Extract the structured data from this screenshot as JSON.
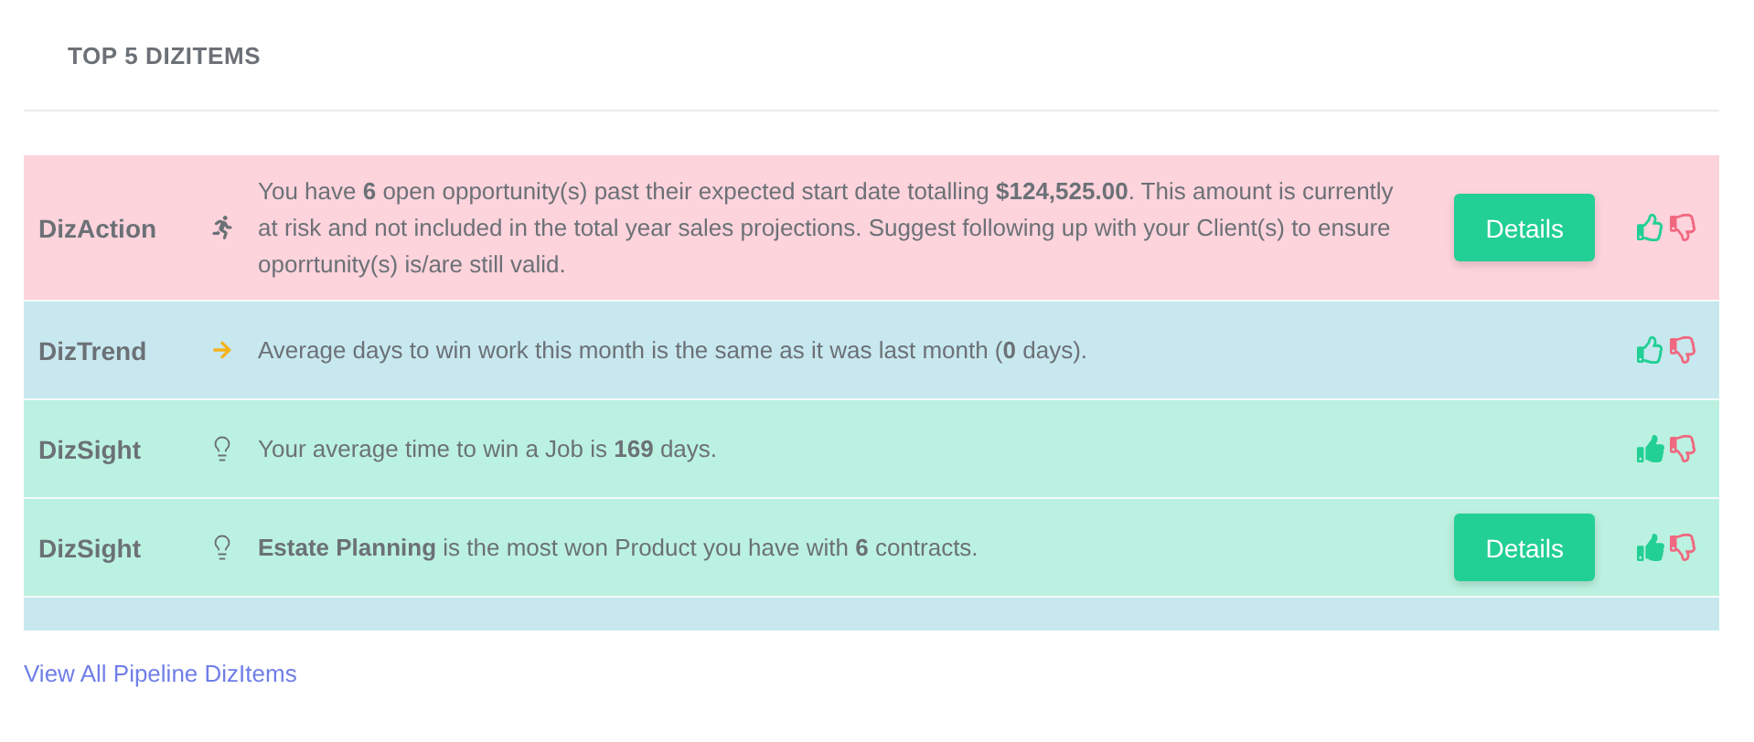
{
  "title": "TOP 5 DIZITEMS",
  "items": [
    {
      "kind": "action",
      "label": "DizAction",
      "text": "You have **6** open opportunity(s) past their expected start date totalling **$124,525.00**. This amount is currently at risk and not included in the total year sales projections. Suggest following up with your Client(s) to ensure oporrtunity(s) is/are still valid.",
      "button": "Details",
      "liked": false,
      "disliked": false
    },
    {
      "kind": "trend",
      "label": "DizTrend",
      "text": "Average days to win work this month is the same as it was last month (**0** days).",
      "liked": false,
      "disliked": false
    },
    {
      "kind": "sight",
      "label": "DizSight",
      "text": "Your average time to win a Job is **169** days.",
      "liked": true,
      "disliked": false
    },
    {
      "kind": "sight",
      "label": "DizSight",
      "text": "**Estate Planning** is the most won Product you have with **6** contracts.",
      "button": "Details",
      "liked": true,
      "disliked": false
    }
  ],
  "link": "View All Pipeline DizItems"
}
